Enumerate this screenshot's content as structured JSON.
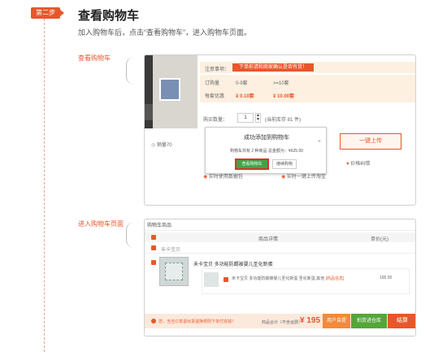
{
  "step": {
    "badge": "第二步",
    "title": "查看购物车",
    "subtitle": "加入购物车后，点击“查看购物车”，进入购物车页面。"
  },
  "section1": {
    "label": "查看购物车",
    "product": {
      "notice_label": "注意事项：",
      "notice_text": "下单前请和商家确认是否有货！",
      "qty_label": "订购量",
      "qty_range_1": "0-9套",
      "qty_range_2": ">=10套",
      "price_label": "每套优惠",
      "price_1": "¥ 0.10套",
      "price_2": "¥ 10.00套",
      "buy_qty_label": "购买数量：",
      "buy_qty_value": "1",
      "stock_text": "(当前库存 81 件)",
      "sales_text": "销量70",
      "favorite_label": "价格纠错",
      "upload_button": "一键上传",
      "link_1": "实时使用数据包",
      "link_2": "实时一键上传淘宝"
    },
    "popup": {
      "title": "成功添加到购物车",
      "summary": "购物车共有 2 种商品 总金额为：¥625.00",
      "view_cart_button": "查看购物车",
      "continue_button": "继续购物",
      "close_glyph": "×"
    }
  },
  "section2": {
    "label": "进入购物车页面",
    "cart": {
      "header": "购物车商品",
      "col_detail": "商品详情",
      "col_price": "单价(元)",
      "shop_name": "禾卡宝贝",
      "item_title": "禾卡宝贝 多功能防踢被婴儿圣化新蛋",
      "sub_item_title": "禾卡宝贝 多功能防踢被婴儿圣化新蛋 圣化新蛋,其他",
      "sub_item_tag": "[商品信息]",
      "sub_item_price": "195.00",
      "footer_notice": "您，当当订单退出货退换规则下单付完钱！",
      "total_label": "商品合计（不含运费）",
      "total_value": "¥ 195",
      "btn_pickup": "用户自提",
      "btn_warehouse": "拍货进仓库",
      "btn_checkout": "结算"
    }
  }
}
